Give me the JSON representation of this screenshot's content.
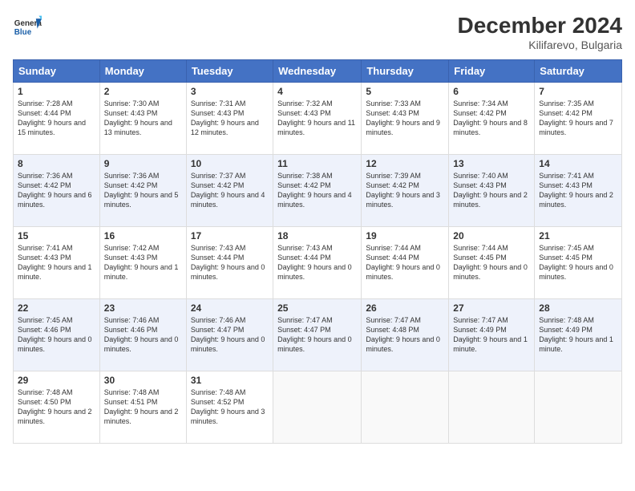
{
  "header": {
    "logo_line1": "General",
    "logo_line2": "Blue",
    "month": "December 2024",
    "location": "Kilifarevo, Bulgaria"
  },
  "days_of_week": [
    "Sunday",
    "Monday",
    "Tuesday",
    "Wednesday",
    "Thursday",
    "Friday",
    "Saturday"
  ],
  "weeks": [
    [
      {
        "day": 1,
        "sunrise": "7:28 AM",
        "sunset": "4:44 PM",
        "daylight": "9 hours and 15 minutes."
      },
      {
        "day": 2,
        "sunrise": "7:30 AM",
        "sunset": "4:43 PM",
        "daylight": "9 hours and 13 minutes."
      },
      {
        "day": 3,
        "sunrise": "7:31 AM",
        "sunset": "4:43 PM",
        "daylight": "9 hours and 12 minutes."
      },
      {
        "day": 4,
        "sunrise": "7:32 AM",
        "sunset": "4:43 PM",
        "daylight": "9 hours and 11 minutes."
      },
      {
        "day": 5,
        "sunrise": "7:33 AM",
        "sunset": "4:43 PM",
        "daylight": "9 hours and 9 minutes."
      },
      {
        "day": 6,
        "sunrise": "7:34 AM",
        "sunset": "4:42 PM",
        "daylight": "9 hours and 8 minutes."
      },
      {
        "day": 7,
        "sunrise": "7:35 AM",
        "sunset": "4:42 PM",
        "daylight": "9 hours and 7 minutes."
      }
    ],
    [
      {
        "day": 8,
        "sunrise": "7:36 AM",
        "sunset": "4:42 PM",
        "daylight": "9 hours and 6 minutes."
      },
      {
        "day": 9,
        "sunrise": "7:36 AM",
        "sunset": "4:42 PM",
        "daylight": "9 hours and 5 minutes."
      },
      {
        "day": 10,
        "sunrise": "7:37 AM",
        "sunset": "4:42 PM",
        "daylight": "9 hours and 4 minutes."
      },
      {
        "day": 11,
        "sunrise": "7:38 AM",
        "sunset": "4:42 PM",
        "daylight": "9 hours and 4 minutes."
      },
      {
        "day": 12,
        "sunrise": "7:39 AM",
        "sunset": "4:42 PM",
        "daylight": "9 hours and 3 minutes."
      },
      {
        "day": 13,
        "sunrise": "7:40 AM",
        "sunset": "4:43 PM",
        "daylight": "9 hours and 2 minutes."
      },
      {
        "day": 14,
        "sunrise": "7:41 AM",
        "sunset": "4:43 PM",
        "daylight": "9 hours and 2 minutes."
      }
    ],
    [
      {
        "day": 15,
        "sunrise": "7:41 AM",
        "sunset": "4:43 PM",
        "daylight": "9 hours and 1 minute."
      },
      {
        "day": 16,
        "sunrise": "7:42 AM",
        "sunset": "4:43 PM",
        "daylight": "9 hours and 1 minute."
      },
      {
        "day": 17,
        "sunrise": "7:43 AM",
        "sunset": "4:44 PM",
        "daylight": "9 hours and 0 minutes."
      },
      {
        "day": 18,
        "sunrise": "7:43 AM",
        "sunset": "4:44 PM",
        "daylight": "9 hours and 0 minutes."
      },
      {
        "day": 19,
        "sunrise": "7:44 AM",
        "sunset": "4:44 PM",
        "daylight": "9 hours and 0 minutes."
      },
      {
        "day": 20,
        "sunrise": "7:44 AM",
        "sunset": "4:45 PM",
        "daylight": "9 hours and 0 minutes."
      },
      {
        "day": 21,
        "sunrise": "7:45 AM",
        "sunset": "4:45 PM",
        "daylight": "9 hours and 0 minutes."
      }
    ],
    [
      {
        "day": 22,
        "sunrise": "7:45 AM",
        "sunset": "4:46 PM",
        "daylight": "9 hours and 0 minutes."
      },
      {
        "day": 23,
        "sunrise": "7:46 AM",
        "sunset": "4:46 PM",
        "daylight": "9 hours and 0 minutes."
      },
      {
        "day": 24,
        "sunrise": "7:46 AM",
        "sunset": "4:47 PM",
        "daylight": "9 hours and 0 minutes."
      },
      {
        "day": 25,
        "sunrise": "7:47 AM",
        "sunset": "4:47 PM",
        "daylight": "9 hours and 0 minutes."
      },
      {
        "day": 26,
        "sunrise": "7:47 AM",
        "sunset": "4:48 PM",
        "daylight": "9 hours and 0 minutes."
      },
      {
        "day": 27,
        "sunrise": "7:47 AM",
        "sunset": "4:49 PM",
        "daylight": "9 hours and 1 minute."
      },
      {
        "day": 28,
        "sunrise": "7:48 AM",
        "sunset": "4:49 PM",
        "daylight": "9 hours and 1 minute."
      }
    ],
    [
      {
        "day": 29,
        "sunrise": "7:48 AM",
        "sunset": "4:50 PM",
        "daylight": "9 hours and 2 minutes."
      },
      {
        "day": 30,
        "sunrise": "7:48 AM",
        "sunset": "4:51 PM",
        "daylight": "9 hours and 2 minutes."
      },
      {
        "day": 31,
        "sunrise": "7:48 AM",
        "sunset": "4:52 PM",
        "daylight": "9 hours and 3 minutes."
      },
      null,
      null,
      null,
      null
    ]
  ]
}
